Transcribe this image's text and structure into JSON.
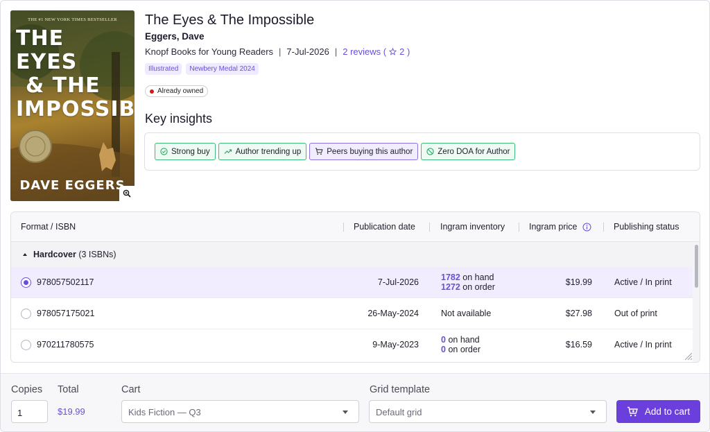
{
  "book": {
    "cover": {
      "nyt_line": "THE #1 NEW YORK TIMES BESTSELLER",
      "title_line1": "THE EYES",
      "title_line2": "& THE",
      "title_line3": "IMPOSSIBLE",
      "author": "DAVE EGGERS"
    },
    "title": "The Eyes & The Impossible",
    "author": "Eggers, Dave",
    "publisher": "Knopf Books for Young Readers",
    "separator": "|",
    "pub_date": "7-Jul-2026",
    "reviews_label": "2 reviews (",
    "reviews_rating": "2 )",
    "tags": [
      "Illustrated",
      "Newbery Medal 2024"
    ],
    "owned_label": "Already owned"
  },
  "insights": {
    "heading": "Key insights",
    "chips": [
      {
        "label": "Strong buy",
        "icon": "check-circle-icon",
        "color": "#3dbb77"
      },
      {
        "label": "Author trending up",
        "icon": "trending-up-icon",
        "color": "#3dbb77"
      },
      {
        "label": "Peers buying this author",
        "icon": "cart-icon",
        "color": "#8b72e0"
      },
      {
        "label": "Zero DOA for Author",
        "icon": "no-entry-icon",
        "color": "#3dbb77"
      }
    ]
  },
  "table": {
    "headers": [
      "Format / ISBN",
      "Publication date",
      "Ingram inventory",
      "Ingram price",
      "Publishing status"
    ],
    "group": {
      "name": "Hardcover",
      "count": "(3 ISBNs)"
    },
    "rows": [
      {
        "isbn": "978057502117",
        "date": "7-Jul-2026",
        "on_hand": "1782",
        "on_hand_label": "on hand",
        "on_order": "1272",
        "on_order_label": "on order",
        "price": "$19.99",
        "status": "Active / In print",
        "selected": true
      },
      {
        "isbn": "978057175021",
        "date": "26-May-2024",
        "inventory": "Not available",
        "price": "$27.98",
        "status": "Out of print",
        "selected": false
      },
      {
        "isbn": "970211780575",
        "date": "9-May-2023",
        "on_hand": "0",
        "on_hand_label": "on hand",
        "on_order": "0",
        "on_order_label": "on order",
        "price": "$16.59",
        "status": "Active / In print",
        "selected": false
      }
    ]
  },
  "footer": {
    "copies_label": "Copies",
    "copies_value": "1",
    "total_label": "Total",
    "total_value": "$19.99",
    "cart_label": "Cart",
    "cart_value": "Kids Fiction — Q3",
    "grid_label": "Grid template",
    "grid_value": "Default grid",
    "add_button": "Add to cart"
  },
  "colors": {
    "accent": "#6a3fdc",
    "accent_text": "#6a4fd8",
    "success": "#3dbb77",
    "owned_dot": "#c81e1e"
  }
}
